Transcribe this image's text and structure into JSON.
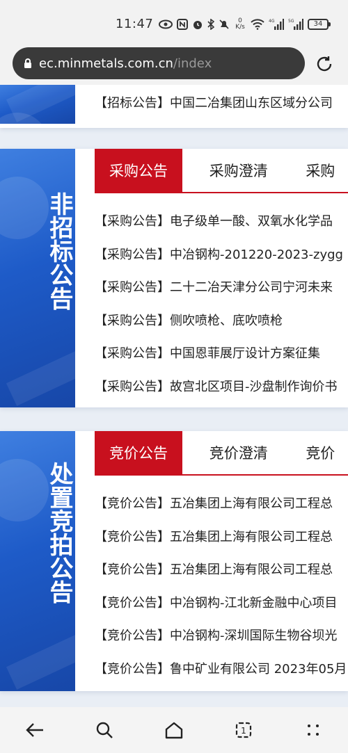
{
  "status": {
    "time": "11:47",
    "net_speed_value": "0",
    "net_speed_unit": "K/s",
    "signal1_label": "4G",
    "signal2_label": "5G",
    "battery": "34"
  },
  "browser": {
    "url_domain": "ec.minmetals.com.cn",
    "url_path": "/index"
  },
  "top_card": {
    "item": {
      "tag": "【招标公告】",
      "text": "中国二冶集团山东区域分公司"
    }
  },
  "non_tender": {
    "side_title": "非招标公告",
    "tabs": [
      "采购公告",
      "采购澄清",
      "采购"
    ],
    "items": [
      {
        "tag": "【采购公告】",
        "text": "电子级单一酸、双氧水化学品"
      },
      {
        "tag": "【采购公告】",
        "text": "中冶钢构-201220-2023-zygg"
      },
      {
        "tag": "【采购公告】",
        "text": "二十二冶天津分公司宁河未来"
      },
      {
        "tag": "【采购公告】",
        "text": "侧吹喷枪、底吹喷枪"
      },
      {
        "tag": "【采购公告】",
        "text": "中国恩菲展厅设计方案征集"
      },
      {
        "tag": "【采购公告】",
        "text": "故宫北区项目-沙盘制作询价书"
      }
    ]
  },
  "auction": {
    "side_title": "处置竞拍公告",
    "tabs": [
      "竞价公告",
      "竞价澄清",
      "竞价"
    ],
    "items": [
      {
        "tag": "【竞价公告】",
        "text": "五冶集团上海有限公司工程总"
      },
      {
        "tag": "【竞价公告】",
        "text": "五冶集团上海有限公司工程总"
      },
      {
        "tag": "【竞价公告】",
        "text": "五冶集团上海有限公司工程总"
      },
      {
        "tag": "【竞价公告】",
        "text": "中冶钢构-江北新金融中心项目"
      },
      {
        "tag": "【竞价公告】",
        "text": "中冶钢构-深圳国际生物谷坝光"
      },
      {
        "tag": "【竞价公告】",
        "text": "鲁中矿业有限公司 2023年05月"
      }
    ]
  },
  "nav": {
    "icons": [
      "back-icon",
      "search-icon",
      "home-icon",
      "tabs-icon",
      "menu-icon"
    ]
  },
  "colors": {
    "accent": "#c8101e",
    "side_blue": "#1e5bc8",
    "url_bar": "#3a3a3a"
  }
}
